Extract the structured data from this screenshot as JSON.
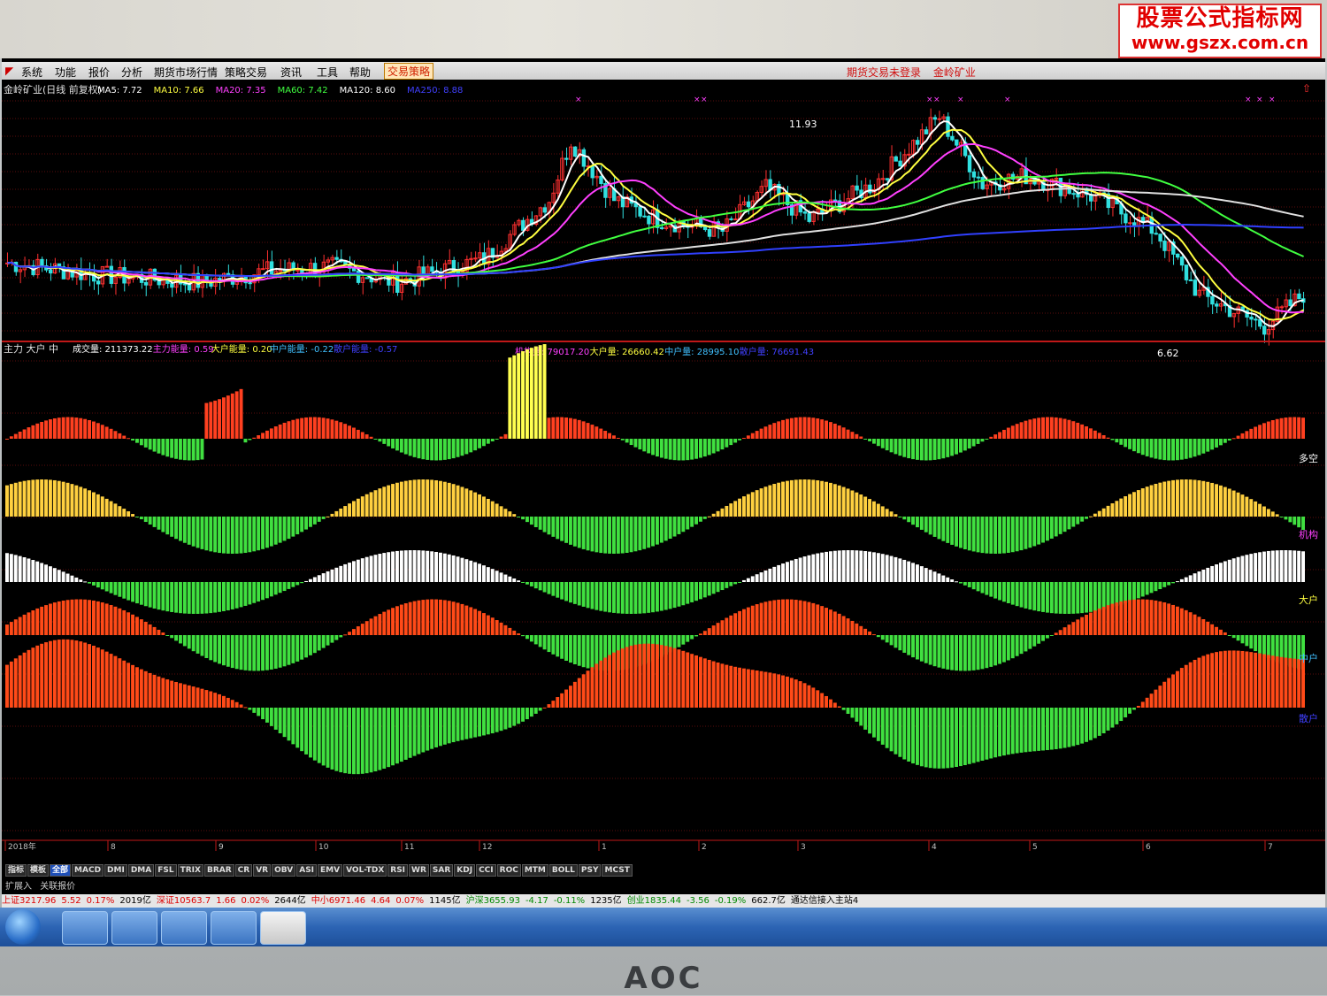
{
  "watermark": {
    "line1": "股票公式指标网",
    "line2": "www.gszx.com.cn"
  },
  "menubar": {
    "items": [
      "系统",
      "功能",
      "报价",
      "分析",
      "期货市场行情",
      "策略交易",
      "资讯",
      "工具",
      "帮助"
    ],
    "strategy": "交易策略",
    "status": [
      "期货交易未登录",
      "金岭矿业"
    ]
  },
  "price_panel": {
    "title": "金岭矿业(日线 前复权)",
    "ma": [
      {
        "label": "MA5: 7.72",
        "color": "#ffffff"
      },
      {
        "label": "MA10: 7.66",
        "color": "#ffff40"
      },
      {
        "label": "MA20: 7.35",
        "color": "#ff40ff"
      },
      {
        "label": "MA60: 7.42",
        "color": "#40ff40"
      },
      {
        "label": "MA120: 8.60",
        "color": "#ffffff"
      },
      {
        "label": "MA250: 8.88",
        "color": "#4040ff"
      }
    ],
    "high_label": "11.93",
    "low_label": "6.62",
    "corner": "⇧",
    "colors": {
      "up": "#ff3030",
      "down": "#30e0e0",
      "ma5": "#ffffff",
      "ma10": "#ffff40",
      "ma20": "#ff40ff",
      "ma60": "#40ff40",
      "ma120": "#e0e0e0",
      "ma250": "#3040ff"
    }
  },
  "flow_panel": {
    "title": "主力 大户 中",
    "stats_left": [
      {
        "label": "成交量: 211373.22",
        "color": "#ffffff"
      },
      {
        "label": "主力能量: 0.59",
        "color": "#ff40ff"
      },
      {
        "label": "大户能量: 0.20",
        "color": "#ffff40"
      },
      {
        "label": "中户能量: -0.22",
        "color": "#40c0ff"
      },
      {
        "label": "散户能量: -0.57",
        "color": "#4040ff"
      }
    ],
    "stats_right": [
      {
        "label": "机构量: 79017.20",
        "color": "#ff40ff"
      },
      {
        "label": "大户量: 26660.42",
        "color": "#ffff40"
      },
      {
        "label": "中户量: 28995.10",
        "color": "#40c0ff"
      },
      {
        "label": "散户量: 76691.43",
        "color": "#4040ff"
      }
    ],
    "side_labels": [
      {
        "text": "多空",
        "color": "#ffffff"
      },
      {
        "text": "机构",
        "color": "#ff40ff"
      },
      {
        "text": "大户",
        "color": "#ffff40"
      },
      {
        "text": "中户",
        "color": "#40c0ff"
      },
      {
        "text": "散户",
        "color": "#4040ff"
      }
    ]
  },
  "time_axis": {
    "labels": [
      "2018年",
      "8",
      "9",
      "10",
      "11",
      "12",
      "1",
      "2",
      "3",
      "4",
      "5",
      "6",
      "7"
    ]
  },
  "indicator_tabs": [
    "指标",
    "模板",
    "全部",
    "MACD",
    "DMI",
    "DMA",
    "FSL",
    "TRIX",
    "BRAR",
    "CR",
    "VR",
    "OBV",
    "ASI",
    "EMV",
    "VOL-TDX",
    "RSI",
    "WR",
    "SAR",
    "KDJ",
    "CCI",
    "ROC",
    "MTM",
    "BOLL",
    "PSY",
    "MCST"
  ],
  "sub_tabs": [
    "扩展入",
    "关联报价"
  ],
  "ticker": [
    {
      "t": "上证3217.96",
      "c": "up"
    },
    {
      "t": "5.52",
      "c": "up"
    },
    {
      "t": "0.17%",
      "c": "up"
    },
    {
      "t": "2019亿",
      "c": ""
    },
    {
      "t": "深证10563.7",
      "c": "up"
    },
    {
      "t": "1.66",
      "c": "up"
    },
    {
      "t": "0.02%",
      "c": "up"
    },
    {
      "t": "2644亿",
      "c": ""
    },
    {
      "t": "中小6971.46",
      "c": "up"
    },
    {
      "t": "4.64",
      "c": "up"
    },
    {
      "t": "0.07%",
      "c": "up"
    },
    {
      "t": "1145亿",
      "c": ""
    },
    {
      "t": "沪深3655.93",
      "c": "dn"
    },
    {
      "t": "-4.17",
      "c": "dn"
    },
    {
      "t": "-0.11%",
      "c": "dn"
    },
    {
      "t": "1235亿",
      "c": ""
    },
    {
      "t": "创业1835.44",
      "c": "dn"
    },
    {
      "t": "-3.56",
      "c": "dn"
    },
    {
      "t": "-0.19%",
      "c": "dn"
    },
    {
      "t": "662.7亿",
      "c": ""
    },
    {
      "t": "通达信接入主站4",
      "c": ""
    }
  ],
  "bezel_brand": "AOC"
}
